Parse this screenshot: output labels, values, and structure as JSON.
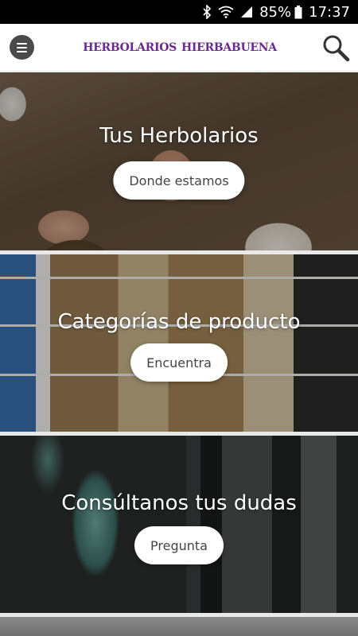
{
  "status_bar": {
    "battery_percent": "85%",
    "time": "17:37",
    "icons": [
      "bluetooth-icon",
      "wifi-icon",
      "signal-icon",
      "battery-icon"
    ]
  },
  "app_bar": {
    "logo_text_left": "HERBOLARIOS",
    "logo_text_right": "HIERBABUENA",
    "icons": [
      "menu-icon",
      "leaf-logo-icon",
      "search-icon"
    ]
  },
  "cards": [
    {
      "title": "Tus Herbolarios",
      "button": "Donde estamos"
    },
    {
      "title": "Categorías de producto",
      "button": "Encuentra"
    },
    {
      "title": "Consúltanos tus dudas",
      "button": "Pregunta"
    }
  ],
  "colors": {
    "logo_purple": "#6a2a8f",
    "logo_leaf_yellow": "#e3b81c",
    "menu_button": "#4a4a4a"
  }
}
